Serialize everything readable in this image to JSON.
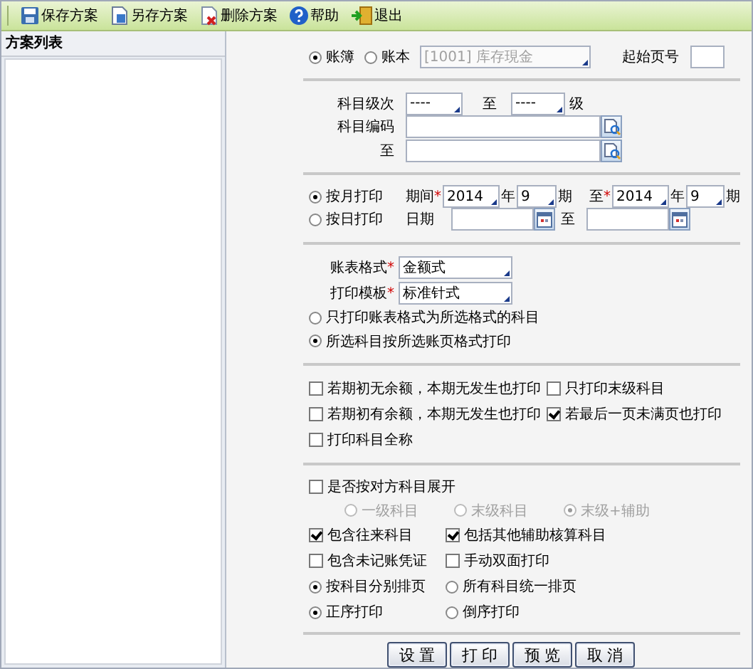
{
  "toolbar": [
    {
      "label": "保存方案"
    },
    {
      "label": "另存方案"
    },
    {
      "label": "删除方案"
    },
    {
      "label": "帮助"
    },
    {
      "label": "退出"
    }
  ],
  "sidebar": {
    "title": "方案列表"
  },
  "book": {
    "options": [
      {
        "label": "账簿",
        "selected": true
      },
      {
        "label": "账本",
        "selected": false
      }
    ],
    "account": {
      "value": "[1001] 库存現金",
      "disabled": true
    },
    "start_page_label": "起始页号"
  },
  "subject_range": {
    "level_label": "科目级次",
    "level_from": "----",
    "level_to_label": "至",
    "level_to": "----",
    "level_unit": "级",
    "code_label": "科目编码",
    "code_to_label": "至"
  },
  "period": {
    "modes": [
      {
        "label": "按月打印",
        "selected": true
      },
      {
        "label": "按日打印",
        "selected": false
      }
    ],
    "month": {
      "label": "期间",
      "mark": "*",
      "from_year": "2014",
      "from_year_unit": "年",
      "from_period": "9",
      "from_period_unit": "期",
      "to_label": "至",
      "to_mark": "*",
      "to_year": "2014",
      "to_year_unit": "年",
      "to_period": "9",
      "to_period_unit": "期"
    },
    "day": {
      "label": "日期",
      "to_label": "至"
    }
  },
  "format": {
    "fields": [
      {
        "label": "账表格式",
        "mark": "*",
        "value": "金额式"
      },
      {
        "label": "打印模板",
        "mark": "*",
        "value": "标准针式"
      }
    ],
    "options": [
      {
        "label": "只打印账表格式为所选格式的科目",
        "selected": false
      },
      {
        "label": "所选科目按所选账页格式打印",
        "selected": true
      }
    ]
  },
  "print_options": [
    {
      "label": "若期初无余额，本期无发生也打印",
      "checked": false
    },
    {
      "label": "只打印末级科目",
      "checked": false
    },
    {
      "label": "若期初有余额，本期无发生也打印",
      "checked": false
    },
    {
      "label": "若最后一页未满页也打印",
      "checked": true
    },
    {
      "label": "打印科目全称",
      "checked": false
    }
  ],
  "expand": {
    "label": "是否按对方科目展开",
    "checked": false,
    "disabled": true,
    "levels": [
      {
        "label": "一级科目",
        "selected": false
      },
      {
        "label": "末级科目",
        "selected": false
      },
      {
        "label": "末级+辅助",
        "selected": true
      }
    ]
  },
  "more_options": [
    {
      "kind": "checkbox",
      "label": "包含往来科目",
      "checked": true
    },
    {
      "kind": "checkbox",
      "label": "包括其他辅助核算科目",
      "checked": true
    },
    {
      "kind": "checkbox",
      "label": "包含未记账凭证",
      "checked": false
    },
    {
      "kind": "checkbox",
      "label": "手动双面打印",
      "checked": false
    },
    {
      "kind": "radio",
      "label": "按科目分别排页",
      "selected": true
    },
    {
      "kind": "radio",
      "label": "所有科目统一排页",
      "selected": false
    },
    {
      "kind": "radio",
      "label": "正序打印",
      "selected": true
    },
    {
      "kind": "radio",
      "label": "倒序打印",
      "selected": false
    }
  ],
  "buttons": [
    "设 置",
    "打 印",
    "预 览",
    "取 消"
  ]
}
